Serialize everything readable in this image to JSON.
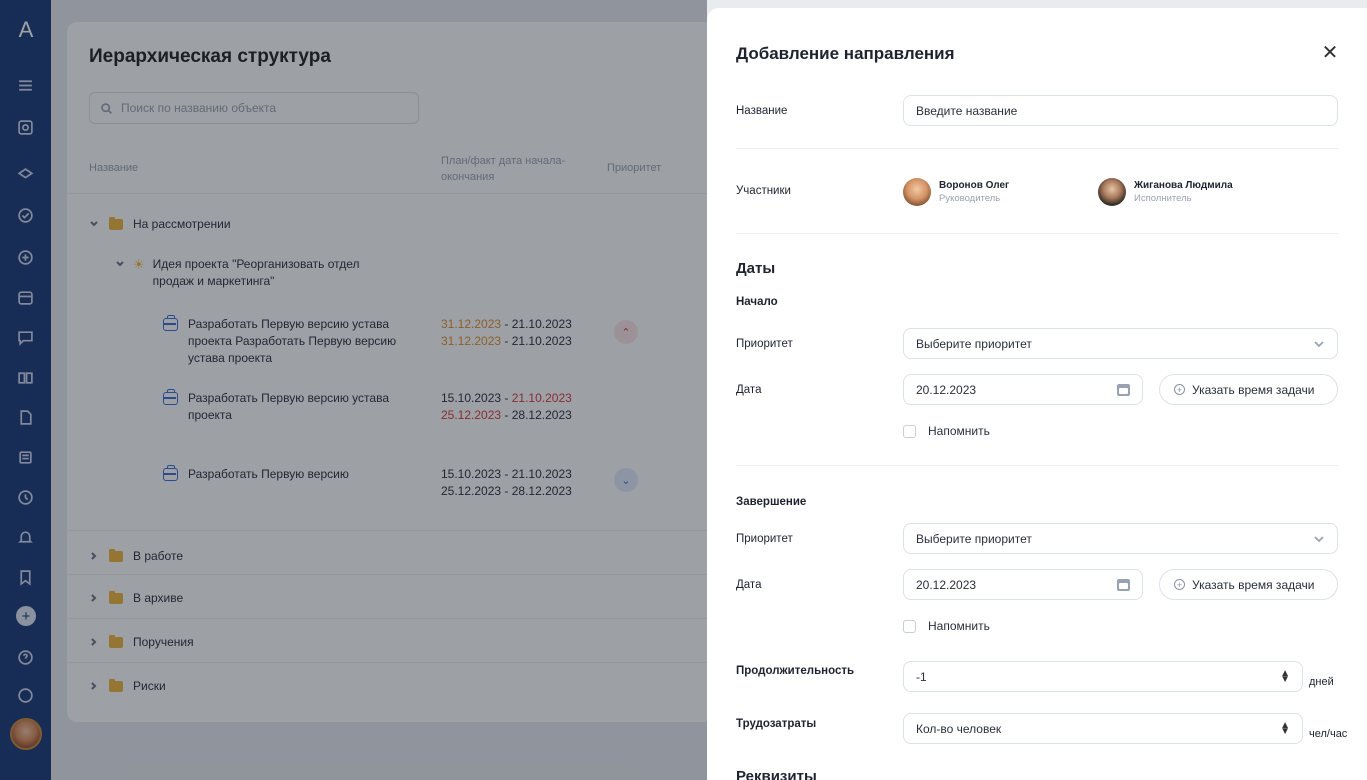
{
  "main": {
    "title": "Иерархическая структура",
    "search_placeholder": "Поиск по названию объекта",
    "columns": [
      "Название",
      "План/факт дата начала-окончания",
      "Приоритет"
    ],
    "folders": [
      "На рассмотрении",
      "В работе",
      "В архиве",
      "Поручения",
      "Риски"
    ],
    "idea_label": "Идея проекта \"Реорганизовать отдел продаж и маркетинга\"",
    "tasks": [
      {
        "name": "Разработать Первую версию устава проекта Разработать Первую версию устава проекта",
        "plan_start": "31.12.2023",
        "plan_end": "21.10.2023",
        "fact_start": "31.12.2023",
        "fact_end": "21.10.2023",
        "priority": "high"
      },
      {
        "name": "Разработать Первую версию устава проекта",
        "plan_start": "15.10.2023",
        "plan_end": "21.10.2023",
        "fact_start": "25.12.2023",
        "fact_end": "28.12.2023",
        "priority": "none"
      },
      {
        "name": "Разработать Первую версию",
        "plan_start": "15.10.2023",
        "plan_end": "21.10.2023",
        "fact_start": "25.12.2023",
        "fact_end": "28.12.2023",
        "priority": "low"
      }
    ],
    "date_sep": " - "
  },
  "drawer": {
    "title": "Добавление направления",
    "close_icon": "close-icon",
    "name_label": "Название",
    "name_placeholder": "Введите название",
    "participants_label": "Участники",
    "participants": [
      {
        "name": "Воронов Олег",
        "role": "Руководитель"
      },
      {
        "name": "Жиганова Людмила",
        "role": "Исполнитель"
      }
    ],
    "dates_section": "Даты",
    "start_label": "Начало",
    "end_label": "Завершение",
    "priority_label": "Приоритет",
    "priority_placeholder": "Выберите приоритет",
    "date_label": "Дата",
    "start_date_value": "20.12.2023",
    "end_date_value": "20.12.2023",
    "time_button": "Указать время задачи",
    "remind_label": "Напомнить",
    "duration_label": "Продолжительность",
    "duration_value": "-1",
    "duration_unit": "дней",
    "effort_label": "Трудозатраты",
    "effort_placeholder": "Кол-во человек",
    "effort_unit": "чел/час",
    "requisites_section": "Реквизиты"
  },
  "colors": {
    "rail": "#1b3a78",
    "accent": "#3a6fd8",
    "folder": "#f2b53b",
    "date_overdue": "#d73c3c",
    "date_warning": "#e0912b"
  }
}
